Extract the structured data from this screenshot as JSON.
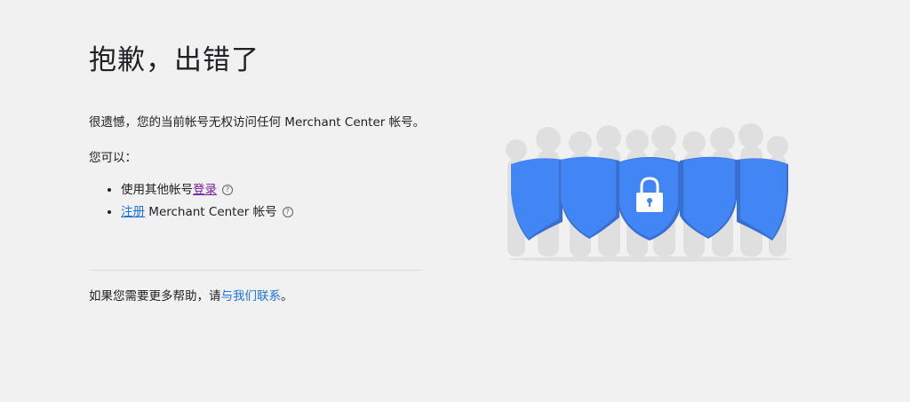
{
  "error": {
    "title": "抱歉，出错了",
    "message": "很遗憾，您的当前帐号无权访问任何 Merchant Center 帐号。",
    "you_can": "您可以："
  },
  "options": {
    "signin_prefix": "使用其他帐号",
    "signin_link": "登录",
    "register_link": "注册",
    "register_suffix": " Merchant Center 帐号",
    "help_glyph": "?"
  },
  "footer": {
    "help_prefix": "如果您需要更多帮助，请",
    "contact_link": "与我们联系",
    "help_suffix": "。"
  },
  "illustration": {
    "icon": "lock-icon",
    "shield_color": "#4285f4",
    "shield_dark_color": "#3a6fd1",
    "silhouette_color": "#dcdcdc"
  }
}
